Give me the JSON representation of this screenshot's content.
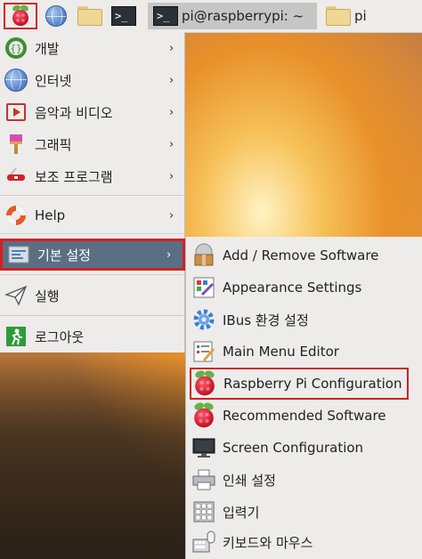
{
  "taskbar": {
    "terminal_prompt": ">_",
    "task_terminal": "pi@raspberrypi: ~",
    "task_folder": "pi"
  },
  "menu": {
    "items": [
      {
        "label": "개발",
        "icon": "gear-dev-icon",
        "has_submenu": true
      },
      {
        "label": "인터넷",
        "icon": "globe-icon",
        "has_submenu": true
      },
      {
        "label": "음악과 비디오",
        "icon": "media-icon",
        "has_submenu": true
      },
      {
        "label": "그래픽",
        "icon": "paintbrush-icon",
        "has_submenu": true
      },
      {
        "label": "보조 프로그램",
        "icon": "swiss-knife-icon",
        "has_submenu": true
      },
      {
        "label": "Help",
        "icon": "lifebuoy-icon",
        "has_submenu": true
      },
      {
        "label": "기본 설정",
        "icon": "preferences-icon",
        "has_submenu": true,
        "active": true
      },
      {
        "label": "실행",
        "icon": "paper-plane-icon",
        "has_submenu": false
      },
      {
        "label": "로그아웃",
        "icon": "exit-icon",
        "has_submenu": false
      }
    ],
    "arrow": "›"
  },
  "submenu": {
    "items": [
      {
        "label": "Add / Remove Software",
        "icon": "package-icon"
      },
      {
        "label": "Appearance Settings",
        "icon": "appearance-icon"
      },
      {
        "label": "IBus 환경 설정",
        "icon": "ibus-gear-icon"
      },
      {
        "label": "Main Menu Editor",
        "icon": "menu-editor-icon"
      },
      {
        "label": "Raspberry Pi Configuration",
        "icon": "raspberry-icon",
        "highlighted": true
      },
      {
        "label": "Recommended Software",
        "icon": "raspberry-icon"
      },
      {
        "label": "Screen Configuration",
        "icon": "monitor-icon"
      },
      {
        "label": "인쇄 설정",
        "icon": "printer-icon"
      },
      {
        "label": "입력기",
        "icon": "keyboard-grid-icon"
      },
      {
        "label": "키보드와 마우스",
        "icon": "keyboard-mouse-icon"
      }
    ]
  },
  "colors": {
    "highlight_border": "#d42020",
    "active_bg": "#5a6f84",
    "menu_bg": "#edeceb"
  }
}
